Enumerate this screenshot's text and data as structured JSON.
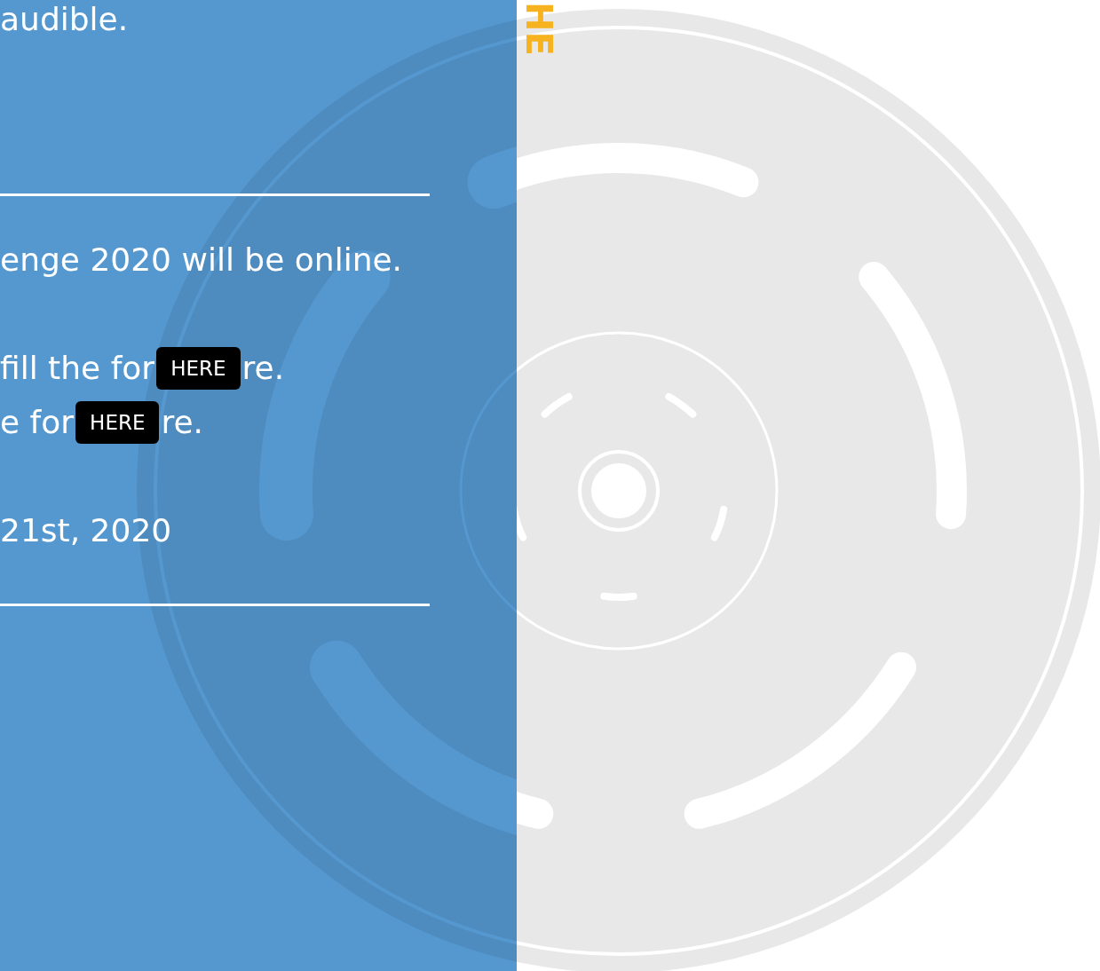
{
  "intro": {
    "text": "audible."
  },
  "details": {
    "lines": [
      {
        "kind": "text",
        "text": "enge 2020 will be online."
      },
      {
        "kind": "link",
        "before": "fill the for",
        "button": "HERE",
        "after": "re."
      },
      {
        "kind": "link",
        "before": "e for",
        "button": "HERE",
        "after": "re."
      },
      {
        "kind": "text",
        "text": "21st, 2020"
      }
    ]
  },
  "side_title": {
    "text": "HE"
  }
}
